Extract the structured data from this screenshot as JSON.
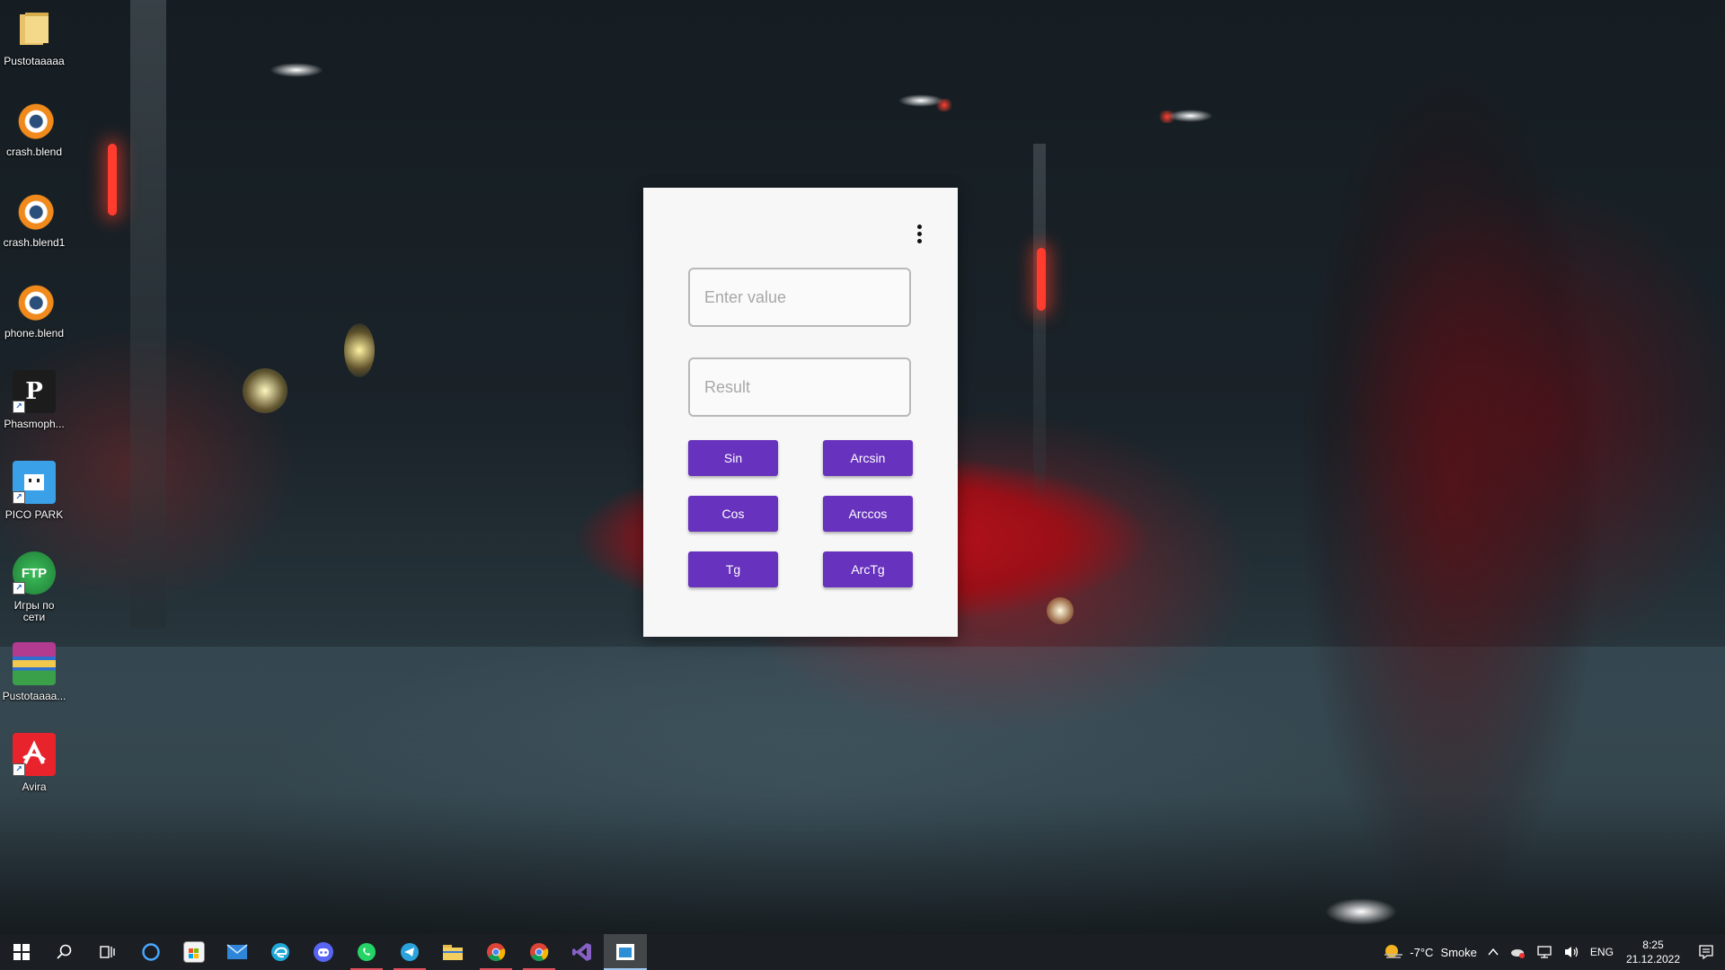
{
  "desktop": {
    "icons": [
      {
        "label": "Pustotaaaaa",
        "icon": "folder-icon",
        "color": "#f2c94c"
      },
      {
        "label": "crash.blend",
        "icon": "blender-icon",
        "color": "#f08a1c"
      },
      {
        "label": "crash.blend1",
        "icon": "blender-icon",
        "color": "#f08a1c"
      },
      {
        "label": "phone.blend",
        "icon": "blender-icon",
        "color": "#f08a1c"
      },
      {
        "label": "Phasmoph...",
        "icon": "phasmophobia-icon",
        "color": "#222222"
      },
      {
        "label": "PICO PARK",
        "icon": "pico-park-icon",
        "color": "#3aa0e8"
      },
      {
        "label": "Игры по сети",
        "icon": "ftp-icon",
        "color": "#2f9e44",
        "glyph": "FTP"
      },
      {
        "label": "Pustotaaaa...",
        "icon": "winrar-icon",
        "color": "#8e44ad"
      },
      {
        "label": "Avira",
        "icon": "avira-icon",
        "color": "#e8232c"
      }
    ]
  },
  "app": {
    "value_placeholder": "Enter value",
    "result_placeholder": "Result",
    "buttons": {
      "sin": "Sin",
      "arcsin": "Arcsin",
      "cos": "Cos",
      "arccos": "Arccos",
      "tg": "Tg",
      "arctg": "ArcTg"
    },
    "accent_color": "#6732bd"
  },
  "taskbar": {
    "pinned": [
      {
        "name": "start",
        "icon": "windows-icon"
      },
      {
        "name": "search",
        "icon": "search-icon"
      },
      {
        "name": "task-view",
        "icon": "task-view-icon"
      },
      {
        "name": "cortana",
        "icon": "cortana-icon"
      },
      {
        "name": "store",
        "icon": "store-icon"
      },
      {
        "name": "mail",
        "icon": "mail-icon"
      },
      {
        "name": "edge",
        "icon": "edge-icon"
      },
      {
        "name": "discord",
        "icon": "discord-icon"
      },
      {
        "name": "whatsapp",
        "icon": "whatsapp-icon"
      },
      {
        "name": "telegram",
        "icon": "telegram-icon"
      },
      {
        "name": "explorer",
        "icon": "folder-icon"
      },
      {
        "name": "chrome",
        "icon": "chrome-icon"
      },
      {
        "name": "chrome-2",
        "icon": "chrome-icon"
      },
      {
        "name": "visual-studio",
        "icon": "visual-studio-icon"
      },
      {
        "name": "app-window",
        "icon": "app-window-icon"
      }
    ],
    "weather": {
      "temp": "-7°C",
      "condition": "Smoke"
    },
    "language": "ENG",
    "time": "8:25",
    "date": "21.12.2022"
  }
}
